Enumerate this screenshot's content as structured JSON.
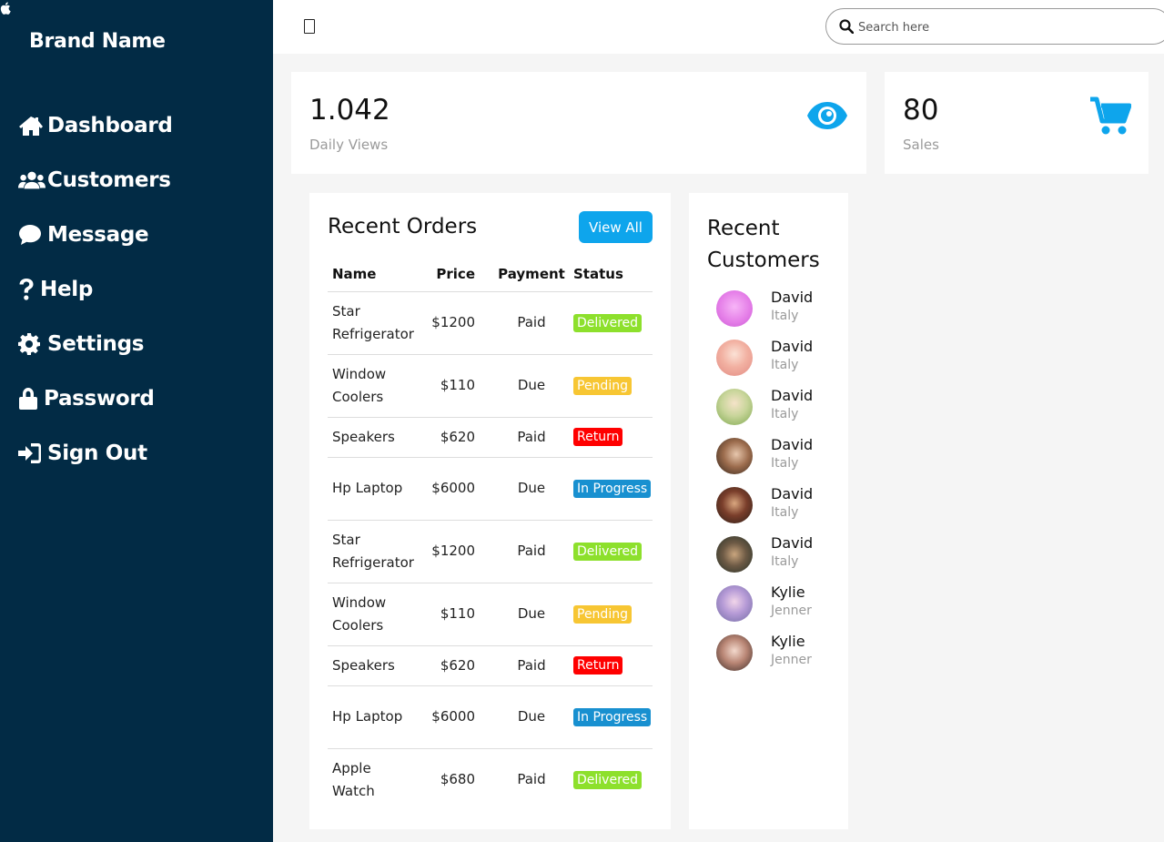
{
  "sidebar": {
    "brand": "Brand Name",
    "items": [
      {
        "label": "Dashboard",
        "icon": "home-icon"
      },
      {
        "label": "Customers",
        "icon": "users-icon"
      },
      {
        "label": "Message",
        "icon": "chat-icon"
      },
      {
        "label": "Help",
        "icon": "question-icon"
      },
      {
        "label": "Settings",
        "icon": "gear-icon"
      },
      {
        "label": "Password",
        "icon": "lock-icon"
      },
      {
        "label": "Sign Out",
        "icon": "sign-out-icon"
      }
    ]
  },
  "topbar": {
    "search_placeholder": "Search here"
  },
  "cards": [
    {
      "number": "1.042",
      "label": "Daily Views",
      "icon": "eye-icon"
    },
    {
      "number": "80",
      "label": "Sales",
      "icon": "cart-icon"
    }
  ],
  "orders": {
    "title": "Recent Orders",
    "view_all": "View All",
    "columns": [
      "Name",
      "Price",
      "Payment",
      "Status"
    ],
    "rows": [
      {
        "name": "Star Refrigerator",
        "price": "$1200",
        "payment": "Paid",
        "status": "Delivered"
      },
      {
        "name": "Window Coolers",
        "price": "$110",
        "payment": "Due",
        "status": "Pending"
      },
      {
        "name": "Speakers",
        "price": "$620",
        "payment": "Paid",
        "status": "Return"
      },
      {
        "name": "Hp Laptop",
        "price": "$6000",
        "payment": "Due",
        "status": "In Progress"
      },
      {
        "name": "Star Refrigerator",
        "price": "$1200",
        "payment": "Paid",
        "status": "Delivered"
      },
      {
        "name": "Window Coolers",
        "price": "$110",
        "payment": "Due",
        "status": "Pending"
      },
      {
        "name": "Speakers",
        "price": "$620",
        "payment": "Paid",
        "status": "Return"
      },
      {
        "name": "Hp Laptop",
        "price": "$6000",
        "payment": "Due",
        "status": "In Progress"
      },
      {
        "name": "Apple Watch",
        "price": "$680",
        "payment": "Paid",
        "status": "Delivered"
      }
    ]
  },
  "customers": {
    "title": "Recent Customers",
    "list": [
      {
        "name": "David",
        "country": "Italy"
      },
      {
        "name": "David",
        "country": "Italy"
      },
      {
        "name": "David",
        "country": "Italy"
      },
      {
        "name": "David",
        "country": "Italy"
      },
      {
        "name": "David",
        "country": "Italy"
      },
      {
        "name": "David",
        "country": "Italy"
      },
      {
        "name": "Kylie",
        "country": "Jenner"
      },
      {
        "name": "Kylie",
        "country": "Jenner"
      }
    ]
  },
  "colors": {
    "sidebar_bg": "#022b45",
    "accent": "#0ea5ec",
    "delivered": "#8de02c",
    "pending": "#f7c633",
    "return": "#ff0000",
    "in_progress": "#1890d0"
  }
}
